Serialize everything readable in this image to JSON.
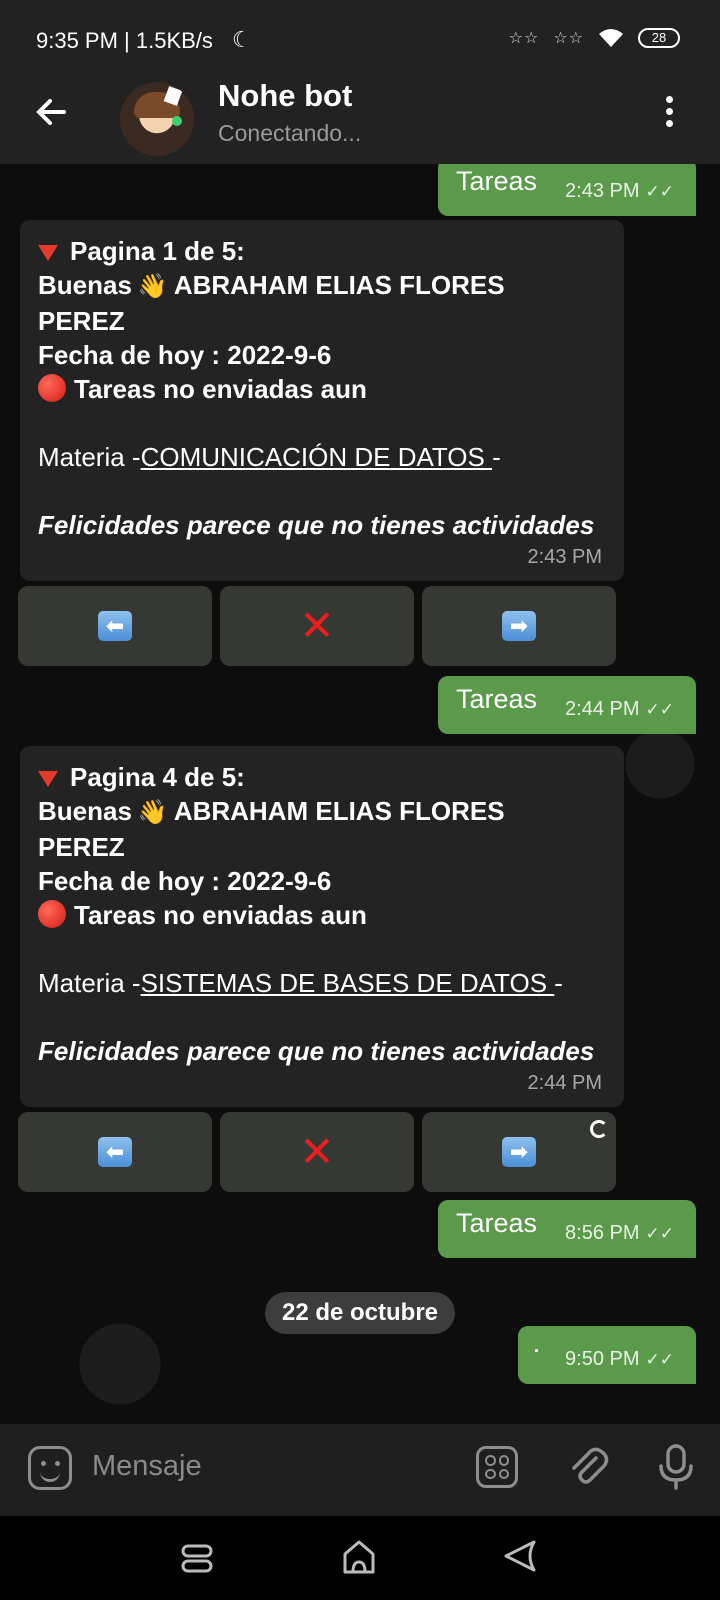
{
  "status_bar": {
    "time": "9:35 PM | 1.5KB/s",
    "signal_1": "☆☆",
    "signal_2": "☆☆",
    "battery": "28"
  },
  "header": {
    "title": "Nohe bot",
    "subtitle": "Conectando..."
  },
  "messages": {
    "out1": {
      "text": "Tareas",
      "time": "2:43 PM"
    },
    "in1": {
      "page": "Pagina 1 de  5:",
      "greeting_prefix": "Buenas",
      "greeting_name": "ABRAHAM ELIAS FLORES",
      "greeting_name2": "PEREZ",
      "date_line": "Fecha de hoy  : 2022-9-6",
      "status": "Tareas no enviadas aun",
      "materia_prefix": "Materia -",
      "materia_name": "COMUNICACIÓN DE DATOS ",
      "materia_suffix": "-",
      "closing": "Felicidades parece que no tienes actividades",
      "time": "2:43 PM"
    },
    "out2": {
      "text": "Tareas",
      "time": "2:44 PM"
    },
    "in2": {
      "page": "Pagina 4 de  5:",
      "greeting_prefix": "Buenas",
      "greeting_name": "ABRAHAM ELIAS FLORES",
      "greeting_name2": "PEREZ",
      "date_line": "Fecha de hoy  : 2022-9-6",
      "status": "Tareas no enviadas aun",
      "materia_prefix": "Materia -",
      "materia_name": "SISTEMAS DE BASES DE DATOS ",
      "materia_suffix": "-",
      "closing": "Felicidades parece que no tienes actividades",
      "time": "2:44 PM"
    },
    "out3": {
      "text": "Tareas",
      "time": "8:56 PM"
    },
    "date_separator": "22 de octubre",
    "out4": {
      "text": "·",
      "time": "9:50 PM"
    }
  },
  "keyboard": {
    "prev_label": "⬅",
    "close_label": "✕",
    "next_label": "➡"
  },
  "input": {
    "placeholder": "Mensaje"
  },
  "colors": {
    "outgoing_bubble": "#5a9a4a",
    "incoming_bubble": "#222322",
    "header_bg": "#212221"
  }
}
